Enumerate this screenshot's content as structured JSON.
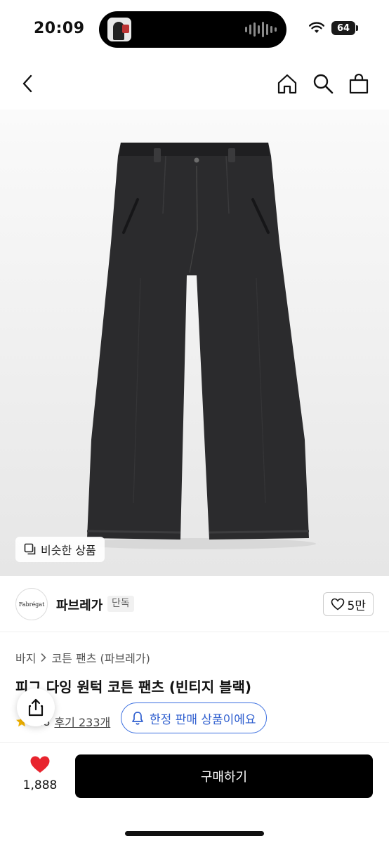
{
  "status_bar": {
    "time": "20:09",
    "battery": "64"
  },
  "nav": {
    "icons": [
      "back-icon",
      "home-icon",
      "search-icon",
      "shopping-bag-icon"
    ]
  },
  "product_image": {
    "similar_label": "비슷한 상품"
  },
  "brand": {
    "logo_text": "Fabrégat",
    "name": "파브레가",
    "badge": "단독",
    "likes": "5만"
  },
  "breadcrumb": {
    "category": "바지",
    "subcategory": "코튼 팬츠 (파브레가)"
  },
  "product": {
    "title": "피그 다잉 원턱 코튼 팬츠 (빈티지 블랙)",
    "rating": "4.8",
    "reviews": "후기 233개"
  },
  "limited": {
    "label": "한정 판매 상품이에요"
  },
  "bottom": {
    "wish_count": "1,888",
    "buy_label": "구매하기"
  },
  "colors": {
    "accent_blue": "#3b6fe0",
    "heart_red": "#e8242e",
    "star_yellow": "#f4b400"
  }
}
